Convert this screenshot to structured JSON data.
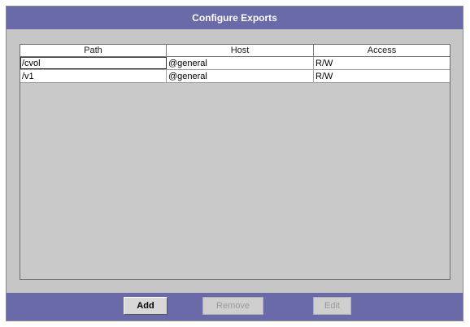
{
  "dialog": {
    "title": "Configure Exports"
  },
  "table": {
    "columns": [
      "Path",
      "Host",
      "Access"
    ],
    "rows": [
      {
        "path": "/cvol",
        "host": "@general",
        "access": "R/W"
      },
      {
        "path": "/v1",
        "host": "@general",
        "access": "R/W"
      }
    ]
  },
  "buttons": {
    "add": {
      "label": "Add",
      "enabled": true
    },
    "remove": {
      "label": "Remove",
      "enabled": false
    },
    "edit": {
      "label": "Edit",
      "enabled": false
    }
  },
  "colors": {
    "title_bar": "#6a6aa9",
    "panel": "#c6c6c6"
  }
}
